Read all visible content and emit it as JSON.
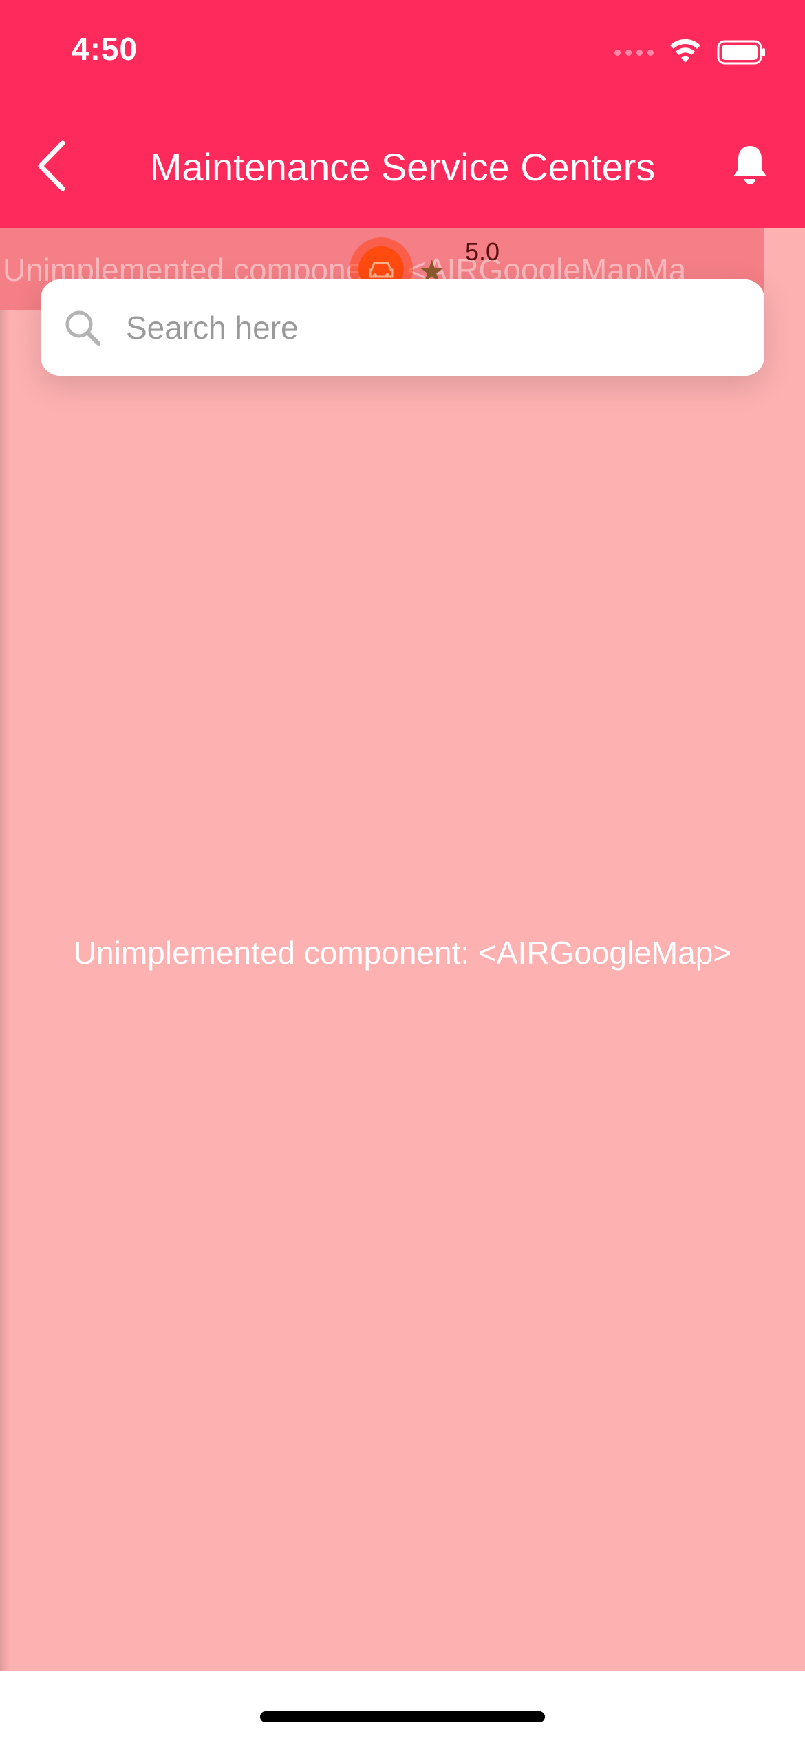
{
  "status_bar": {
    "time": "4:50",
    "wifi_icon": "wifi-icon",
    "battery_icon": "battery-icon"
  },
  "header": {
    "title": "Maintenance Service Centers",
    "back_icon": "chevron-left-icon",
    "bell_icon": "bell-icon",
    "background_color": "#ff2a5c"
  },
  "marker_strip": {
    "text": "Unimplemented component: <AIRGoogleMapMa",
    "rating": "5.0",
    "marker_icon": "car-icon",
    "star_icon": "star-icon"
  },
  "search": {
    "placeholder": "Search here",
    "value": ""
  },
  "map": {
    "placeholder_text": "Unimplemented component: <AIRGoogleMap>",
    "background_color": "#feb1b1"
  }
}
